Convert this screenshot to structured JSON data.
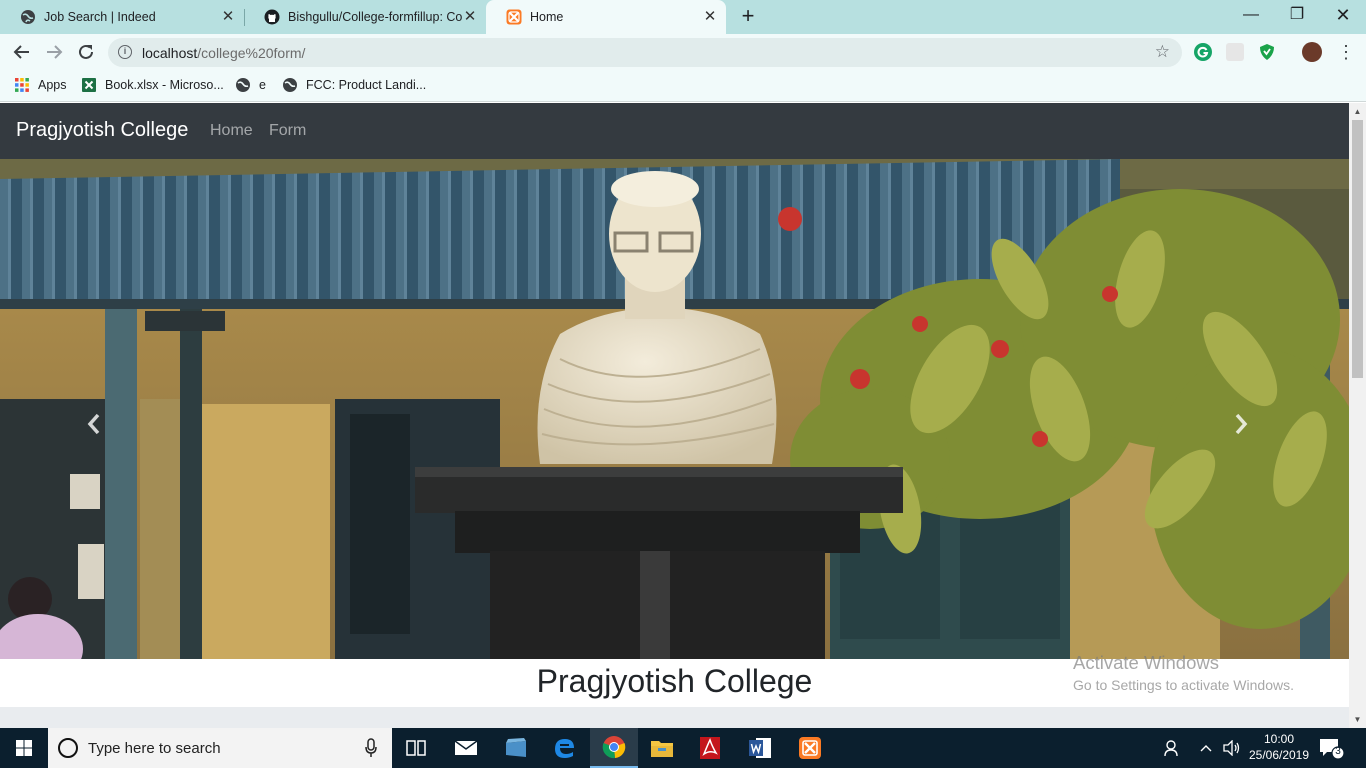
{
  "browser": {
    "tabs": [
      {
        "title": "Job Search | Indeed",
        "favicon": "globe-icon",
        "active": false
      },
      {
        "title": "Bishgullu/College-formfillup: Coll",
        "favicon": "github-icon",
        "active": false
      },
      {
        "title": "Home",
        "favicon": "xampp-icon",
        "active": true
      }
    ],
    "url_host": "localhost",
    "url_path": "/college%20form/",
    "bookmarks": [
      {
        "label": "Apps",
        "icon": "apps-grid-icon"
      },
      {
        "label": "Book.xlsx - Microso...",
        "icon": "excel-icon"
      },
      {
        "label": "e",
        "icon": "globe-icon"
      },
      {
        "label": "FCC: Product Landi...",
        "icon": "globe-icon"
      }
    ]
  },
  "site": {
    "brand": "Pragjyotish College",
    "nav": [
      "Home",
      "Form"
    ],
    "heading": "Pragjyotish College",
    "carousel_prev_icon": "chevron-left-icon",
    "carousel_next_icon": "chevron-right-icon"
  },
  "watermark": {
    "line1": "Activate Windows",
    "line2": "Go to Settings to activate Windows."
  },
  "taskbar": {
    "search_placeholder": "Type here to search",
    "time": "10:00",
    "date": "25/06/2019",
    "notification_count": "3",
    "apps": [
      "task-view-icon",
      "mail-icon",
      "store-icon",
      "edge-icon",
      "chrome-icon",
      "file-explorer-icon",
      "acrobat-icon",
      "word-icon",
      "xampp-icon"
    ]
  },
  "colors": {
    "tabstrip": "#b7e0e0",
    "toolbar": "#f1fafa",
    "navbar": "#343a40",
    "taskbar": "#0b1f2e"
  }
}
